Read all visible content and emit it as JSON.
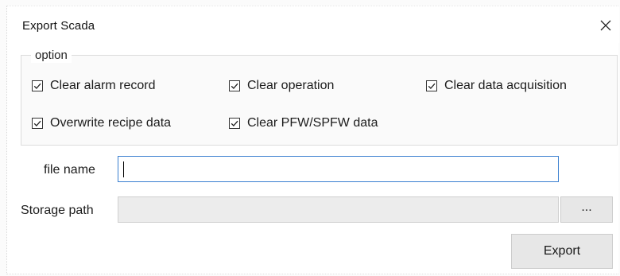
{
  "window": {
    "title": "Export Scada",
    "close_icon": "close-icon"
  },
  "option_group": {
    "legend": "option",
    "checkboxes": [
      {
        "label": "Clear alarm record",
        "checked": true
      },
      {
        "label": "Clear operation",
        "checked": true
      },
      {
        "label": "Clear data acquisition",
        "checked": true
      },
      {
        "label": "Overwrite recipe data",
        "checked": true
      },
      {
        "label": "Clear PFW/SPFW data",
        "checked": true
      }
    ]
  },
  "form": {
    "file_name_label": "file name",
    "file_name_value": "",
    "storage_path_label": "Storage path",
    "storage_path_value": "",
    "browse_button_label": "..."
  },
  "actions": {
    "export_label": "Export"
  },
  "colors": {
    "accent_focus_border": "#3a7fd0",
    "disabled_field": "#ececec",
    "button_face": "#e7e7e7"
  }
}
